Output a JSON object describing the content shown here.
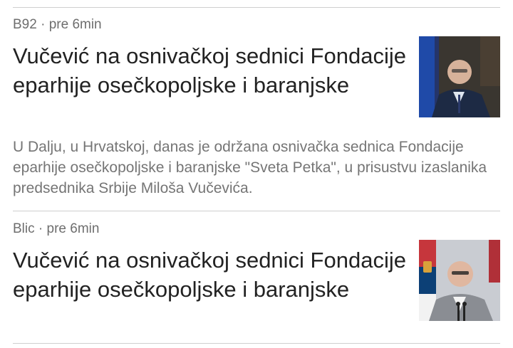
{
  "articles": [
    {
      "source": "B92",
      "time": "pre 6min",
      "title": "Vučević na osnivačkoj sednici Fondacije eparhije osečkopoljske i baranjske",
      "snippet": "U Dalju, u Hrvatskoj, danas je održana osnivačka sednica Fondacije eparhije osečkopoljske i baranjske \"Sveta Petka\", u prisustvu izaslanika predsednika Srbije Miloša Vučevića."
    },
    {
      "source": "Blic",
      "time": "pre 6min",
      "title": "Vučević na osnivačkoj sednici Fondacije eparhije osečkopoljske i baranjske"
    }
  ],
  "separator": " · "
}
